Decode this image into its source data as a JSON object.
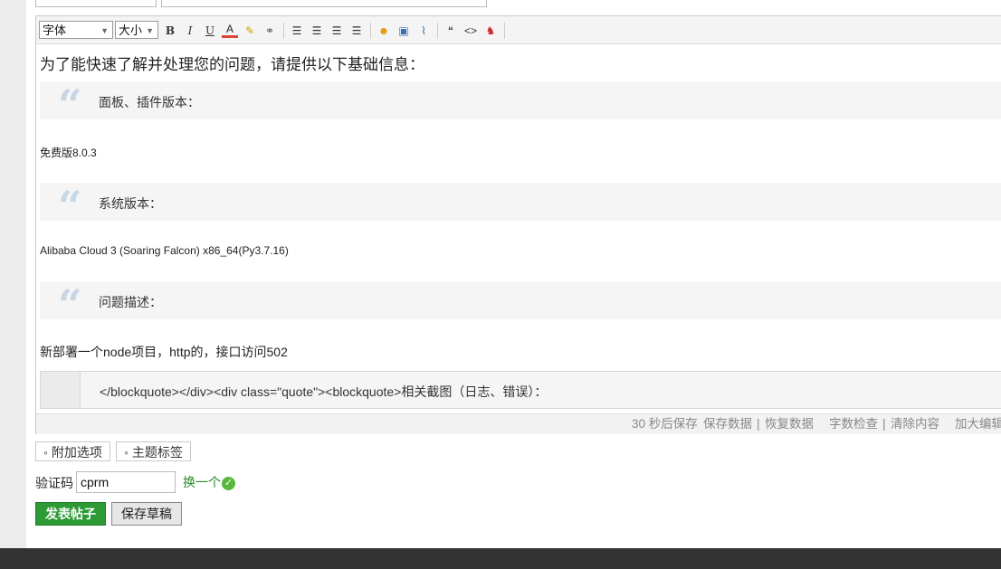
{
  "colors": {
    "accent_green": "#2d9a36",
    "link_green": "#2a8a2a",
    "quote_mark": "#c6d6e4",
    "footer_dark": "#333333"
  },
  "toolbar": {
    "font_select": "字体",
    "size_select": "大小",
    "buttons": [
      "bold-icon",
      "italic-icon",
      "underline-icon",
      "font-color-icon",
      "highlight-icon",
      "link-icon",
      "align-left-icon",
      "align-center-icon",
      "align-justify-icon",
      "align-right-icon",
      "emoji-icon",
      "image-icon",
      "attachment-icon",
      "quote-icon",
      "code-icon",
      "qq-icon"
    ]
  },
  "content": {
    "intro": "为了能快速了解并处理您的问题，请提供以下基础信息：",
    "sections": [
      {
        "label": "面板、插件版本：",
        "value": "免费版8.0.3"
      },
      {
        "label": "系统版本：",
        "value": "Alibaba Cloud 3 (Soaring Falcon) x86_64(Py3.7.16)"
      },
      {
        "label": "问题描述：",
        "value": "新部署一个node项目，http的，接口访问502"
      }
    ],
    "raw_blockquote": "</blockquote></div><div class=\"quote\"><blockquote>相关截图（日志、错误）："
  },
  "statusbar": {
    "autosave": "30 秒后保存",
    "save_data": "保存数据",
    "sep": "|",
    "restore_data": "恢复数据",
    "word_check": "字数检查",
    "clear_content": "清除内容",
    "enlarge": "加大编辑"
  },
  "options": {
    "extra_options": "◦ 附加选项",
    "topic_tags": "◦ 主题标签"
  },
  "captcha": {
    "label": "验证码",
    "value": "cprm",
    "change": "换一个"
  },
  "actions": {
    "submit": "发表帖子",
    "save_draft": "保存草稿"
  }
}
